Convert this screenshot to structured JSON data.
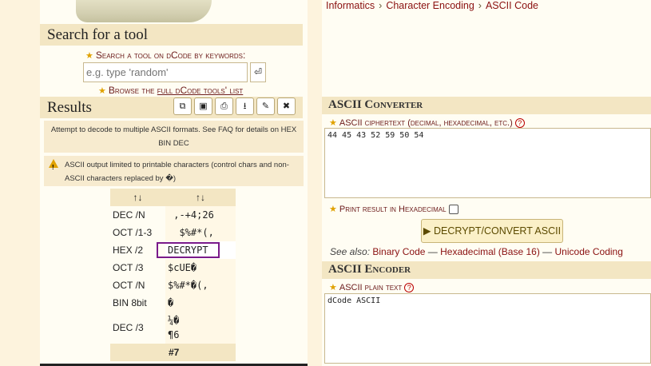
{
  "search": {
    "title": "Search for a tool",
    "label": "Search a tool on dCode by keywords:",
    "placeholder": "e.g. type 'random'",
    "go_icon": "enter-icon",
    "browse_prefix": "Browse the",
    "browse_link": "full dCode tools' list"
  },
  "results": {
    "title": "Results",
    "toolbar_icons": [
      "copy-icon",
      "save-icon",
      "print-icon",
      "download-icon",
      "pin-icon",
      "close-icon"
    ],
    "note": "Attempt to decode to multiple ASCII formats. See FAQ for details on HEX BIN DEC",
    "warning": "ASCII output limited to printable characters (control chars and non-ASCII characters replaced by �)",
    "header": [
      "↑↓",
      "↑↓"
    ],
    "rows": [
      {
        "k": "DEC /N",
        "v": " ,-+4;26"
      },
      {
        "k": "OCT /1-3",
        "v": "  $%#*(,"
      },
      {
        "k": "HEX /2",
        "v": "DECRYPT",
        "highlight": true
      },
      {
        "k": "OCT /3",
        "v": "$cUE�"
      },
      {
        "k": "OCT /N",
        "v": "$%#*�(,"
      },
      {
        "k": "BIN 8bit",
        "v": "�"
      },
      {
        "k": "DEC /3",
        "v": "¼�",
        "v2": "¶6"
      }
    ],
    "footer": "#7"
  },
  "breadcrumb": [
    "Informatics",
    "Character Encoding",
    "ASCII Code"
  ],
  "converter": {
    "title": "ASCII Converter",
    "label": "ASCII ciphertext (decimal, hexadecimal, etc.)",
    "value": "44 45 43 52 59 50 54",
    "hex_label": "Print result in Hexadecimal",
    "button": "▶ DECRYPT/CONVERT ASCII",
    "see_also_label": "See also:",
    "see_also": [
      "Binary Code",
      "Hexadecimal (Base 16)",
      "Unicode Coding"
    ]
  },
  "encoder": {
    "title": "ASCII Encoder",
    "label": "ASCII plain text",
    "value": "dCode ASCII"
  }
}
